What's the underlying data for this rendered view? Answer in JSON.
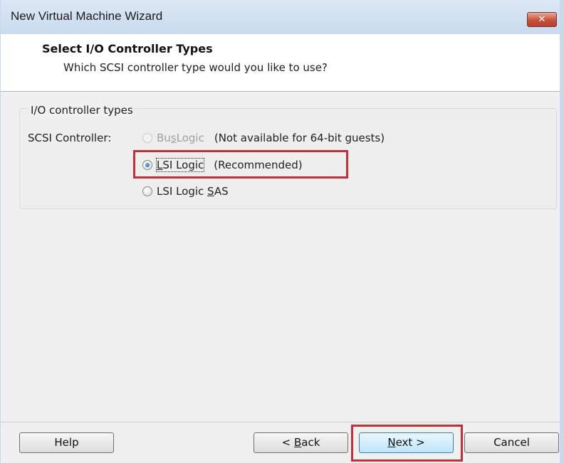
{
  "window": {
    "title": "New Virtual Machine Wizard",
    "close_icon": "close-x-icon",
    "close_glyph": "✕"
  },
  "header": {
    "title": "Select I/O Controller Types",
    "subtitle": "Which SCSI controller type would you like to use?"
  },
  "group": {
    "label": "I/O controller types",
    "scsi_label": "SCSI Controller:",
    "options": [
      {
        "prefix": "Bu",
        "accel": "s",
        "suffix": "Logic",
        "note": "(Not available for 64-bit guests)",
        "enabled": false,
        "selected": false
      },
      {
        "prefix": "",
        "accel": "L",
        "suffix": "SI Logic",
        "note": "(Recommended)",
        "enabled": true,
        "selected": true
      },
      {
        "prefix": "LSI Logic ",
        "accel": "S",
        "suffix": "AS",
        "note": "",
        "enabled": true,
        "selected": false
      }
    ]
  },
  "buttons": {
    "help": "Help",
    "back_prefix": "< ",
    "back_accel": "B",
    "back_suffix": "ack",
    "next_accel": "N",
    "next_suffix": "ext >",
    "cancel": "Cancel"
  },
  "colors": {
    "highlight": "#c2303a",
    "titlebar": "#c9dbef"
  }
}
